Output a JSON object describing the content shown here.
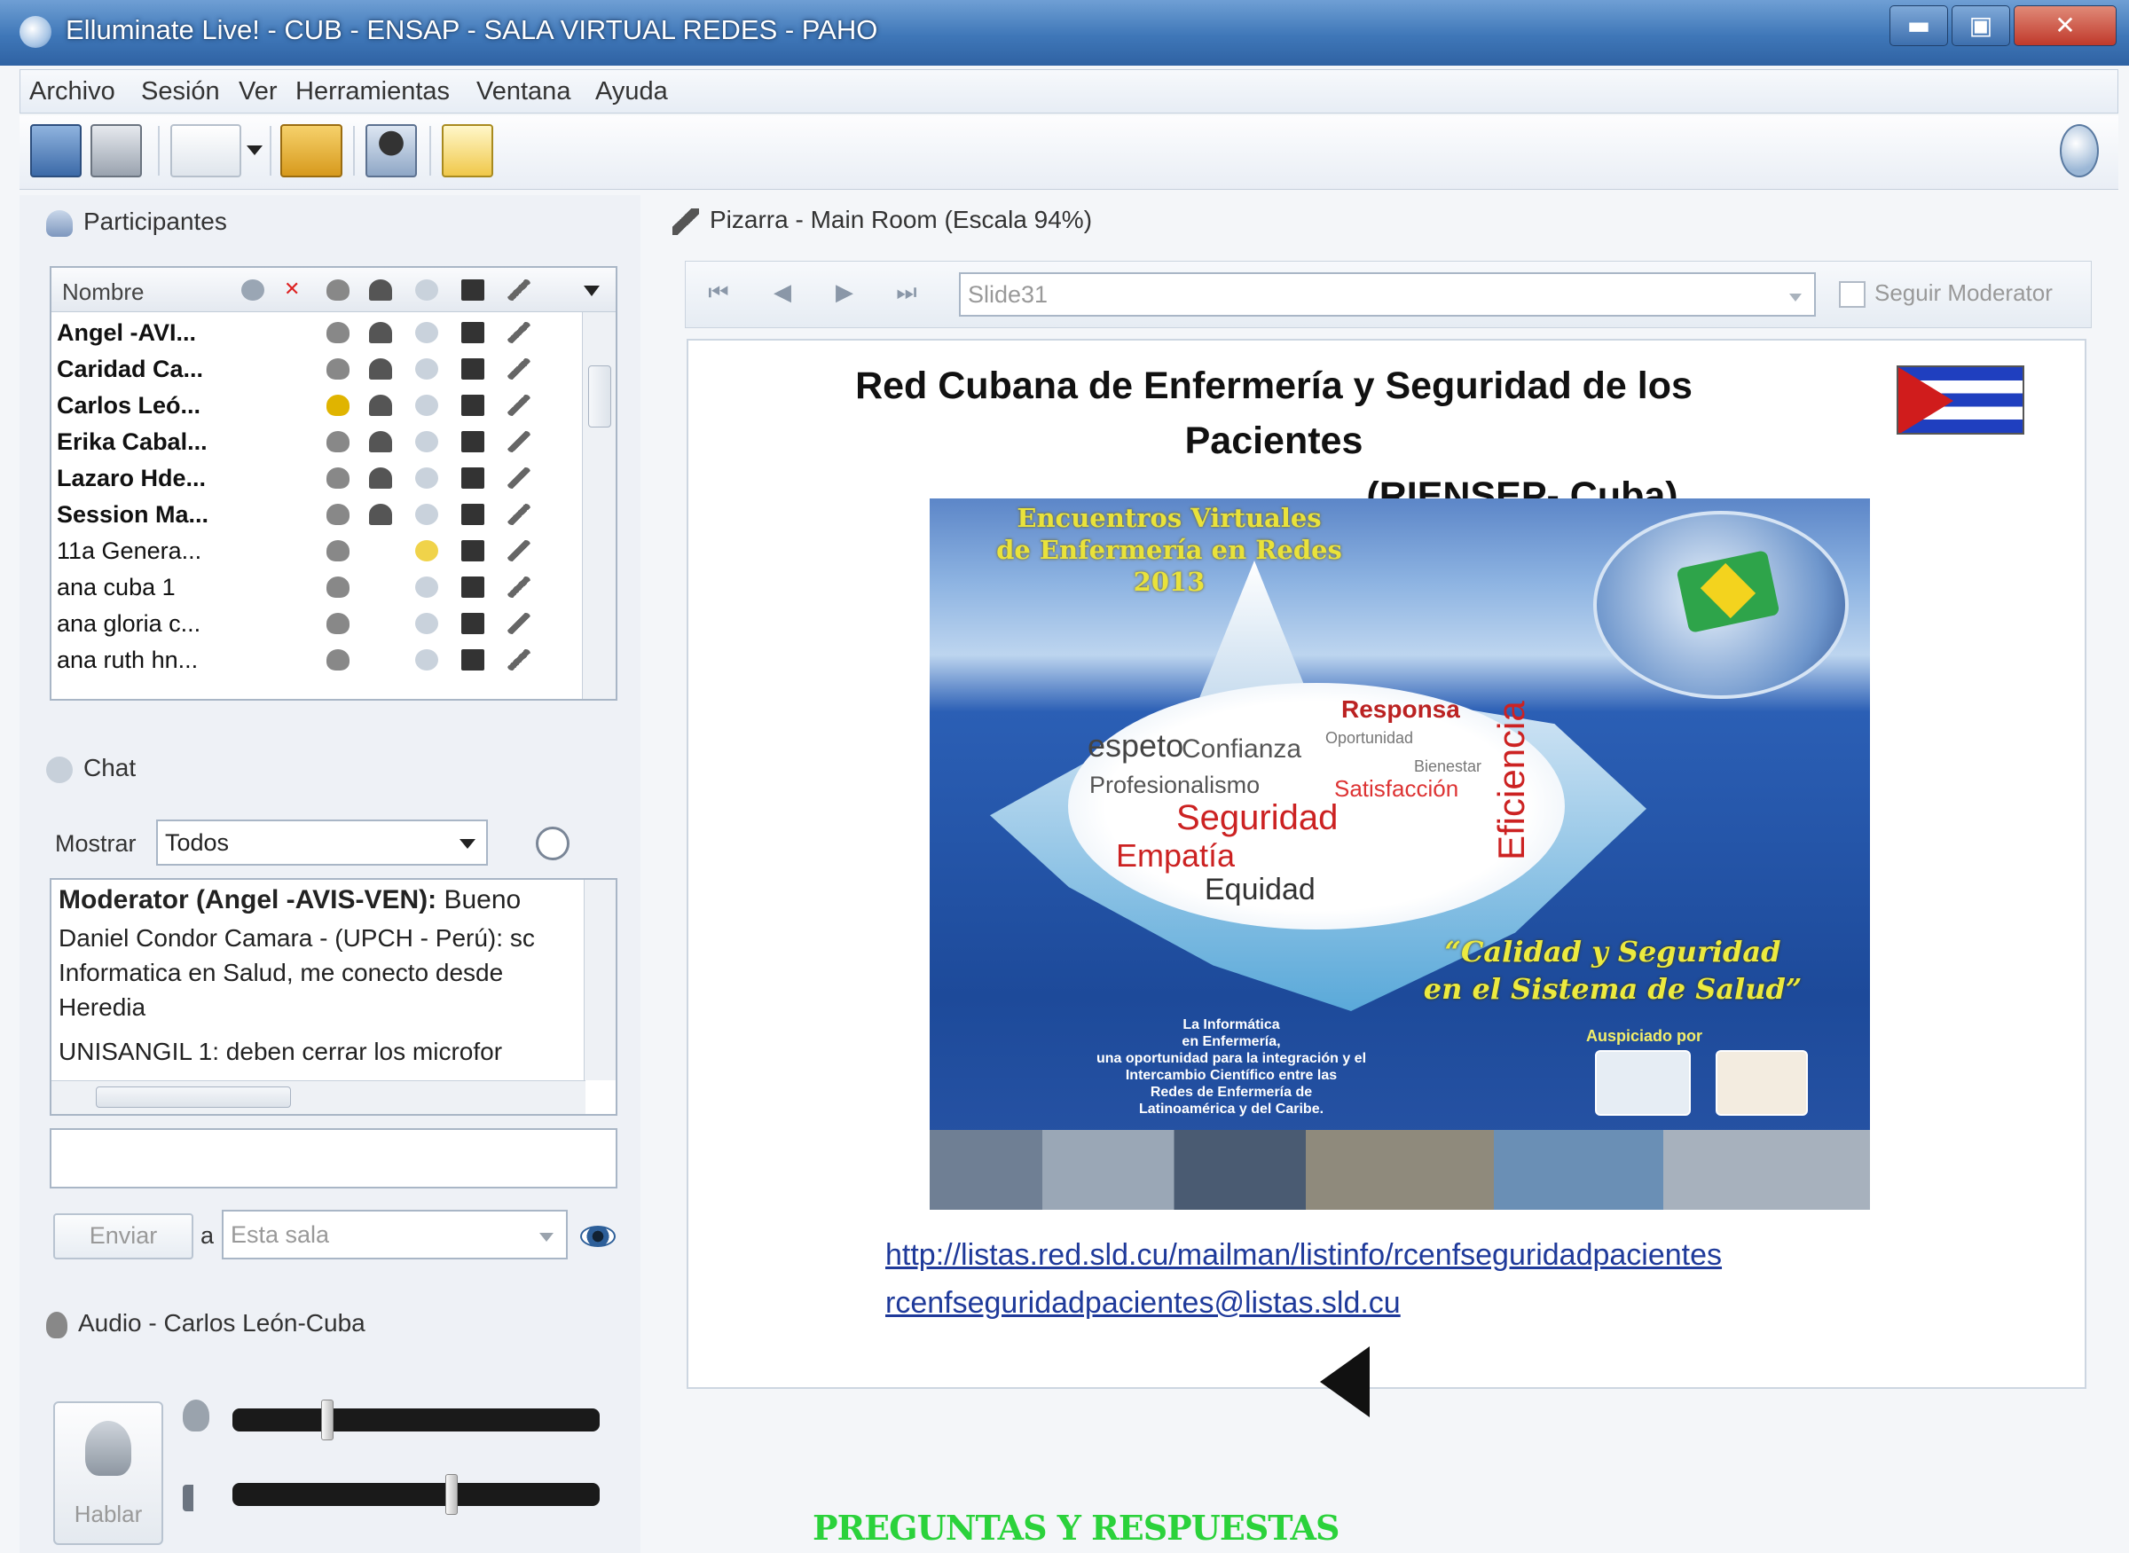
{
  "window": {
    "title": "Elluminate Live! - CUB - ENSAP - SALA VIRTUAL REDES - PAHO",
    "minimize": "▬",
    "maximize": "▣",
    "close": "✕"
  },
  "menu": [
    "Archivo",
    "Sesión",
    "Ver",
    "Herramientas",
    "Ventana",
    "Ayuda"
  ],
  "toolbar": {
    "icons": [
      "save-icon",
      "print-icon",
      "layout-dropdown-icon",
      "load-content-icon",
      "application-share-icon",
      "notes-icon",
      "help-icon"
    ]
  },
  "participants": {
    "header": "Participantes",
    "column_name": "Nombre",
    "rows": [
      {
        "name": "Angel -AVI...",
        "bold": true
      },
      {
        "name": "Caridad Ca...",
        "bold": true
      },
      {
        "name": "Carlos Leó...",
        "bold": true
      },
      {
        "name": "Erika Cabal...",
        "bold": true
      },
      {
        "name": "Lazaro Hde...",
        "bold": true
      },
      {
        "name": "Session Ma...",
        "bold": true
      },
      {
        "name": "11a Genera...",
        "bold": false
      },
      {
        "name": "ana cuba 1",
        "bold": false
      },
      {
        "name": "ana gloria c...",
        "bold": false
      },
      {
        "name": "ana ruth hn...",
        "bold": false
      }
    ]
  },
  "chat": {
    "header": "Chat",
    "show_label": "Mostrar",
    "show_value": "Todos",
    "messages": [
      {
        "sender": "Moderator (Angel -AVIS-VEN):",
        "text": " Bueno"
      },
      {
        "sender": "",
        "text": "Daniel Condor Camara - (UPCH - Perú): sc"
      },
      {
        "sender": "",
        "text": "Informatica en Salud, me conecto desde"
      },
      {
        "sender": "",
        "text": "Heredia"
      },
      {
        "sender": "",
        "text": "UNISANGIL 1: deben cerrar  los  microfor"
      }
    ],
    "send_button": "Enviar",
    "to_label": "a",
    "to_value": "Esta sala"
  },
  "audio": {
    "header": "Audio - Carlos León-Cuba",
    "talk_button": "Hablar",
    "mic_level": 0.25,
    "speaker_level": 0.6
  },
  "whiteboard": {
    "header": "Pizarra - Main Room (Escala 94%)",
    "slide_value": "Slide31",
    "follow_moderator": "Seguir Moderator",
    "slide_title_line1": "Red Cubana de Enfermería y Seguridad de los Pacientes",
    "slide_title_line2": "(RIENSEP- Cuba)",
    "poster": {
      "top_text_1": "Encuentros Virtuales",
      "top_text_2": "de Enfermería  en Redes",
      "top_text_3": "2013",
      "words": [
        "Responsa",
        "espeto",
        "Confianza",
        "Oportunidad",
        "Bienestar",
        "Profesionalismo",
        "Satisfacción",
        "Seguridad",
        "Empatía",
        "Equidad",
        "Eficiencia"
      ],
      "slogan_1": "“Calidad y Seguridad",
      "slogan_2": "en el Sistema de Salud”",
      "sponsor": "Auspiciado por",
      "body_1": "La Informática",
      "body_2": "en Enfermería,",
      "body_3": "una oportunidad para la integración y el",
      "body_4": "Intercambio Científico entre las",
      "body_5": "Redes de Enfermería de",
      "body_6": "Latinoamérica y del Caribe."
    },
    "link_1": "http://listas.red.sld.cu/mailman/listinfo/rcenfseguridadpacientes",
    "link_2": "rcenfseguridadpacientes@listas.sld.cu"
  },
  "footer_caption": "PREGUNTAS Y RESPUESTAS",
  "colors": {
    "accent": "#3f77b8",
    "link": "#1f3a9a",
    "caption_green": "#2bd23b"
  }
}
